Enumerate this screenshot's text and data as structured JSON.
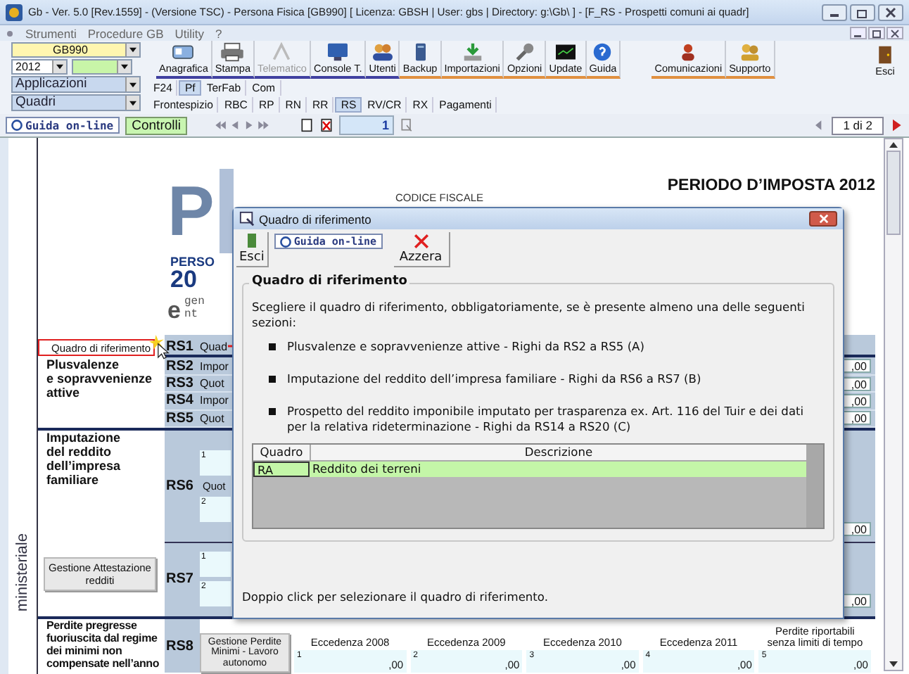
{
  "window": {
    "title": "Gb - Ver. 5.0 [Rev.1559] - (Versione TSC) -  Persona Fisica [GB990]     [ Licenza: GBSH | User: gbs | Directory: g:\\Gb\\ ] - [F_RS - Prospetti comuni ai quadr]"
  },
  "menu": [
    "Strumenti",
    "Procedure GB",
    "Utility",
    "?"
  ],
  "selectors": {
    "company": "GB990",
    "year": "2012",
    "applications": "Applicazioni",
    "frames": "Quadri"
  },
  "toolbar": [
    {
      "label": "Anagrafica",
      "disabled": false
    },
    {
      "label": "Stampa",
      "disabled": false
    },
    {
      "label": "Telematico",
      "disabled": true
    },
    {
      "label": "Console T.",
      "disabled": false
    },
    {
      "label": "Utenti",
      "disabled": false
    },
    {
      "label": "Backup",
      "disabled": false
    },
    {
      "label": "Importazioni",
      "disabled": false
    },
    {
      "label": "Opzioni",
      "disabled": false
    },
    {
      "label": "Update",
      "disabled": false
    },
    {
      "label": "Guida",
      "disabled": false
    }
  ],
  "toolbar_right": [
    {
      "label": "Comunicazioni"
    },
    {
      "label": "Supporto"
    }
  ],
  "exit_button": "Esci",
  "tabs": [
    {
      "label": "F24",
      "selected": false
    },
    {
      "label": "Pf",
      "selected": true
    },
    {
      "label": "TerFab",
      "selected": false
    },
    {
      "label": "Com",
      "selected": false
    }
  ],
  "subtabs": [
    {
      "label": "Frontespizio",
      "selected": false
    },
    {
      "label": "RBC",
      "selected": false
    },
    {
      "label": "RP",
      "selected": false
    },
    {
      "label": "RN",
      "selected": false
    },
    {
      "label": "RR",
      "selected": false
    },
    {
      "label": "RS",
      "selected": true
    },
    {
      "label": "RV/CR",
      "selected": false
    },
    {
      "label": "RX",
      "selected": false
    },
    {
      "label": "Pagamenti",
      "selected": false
    }
  ],
  "navbar": {
    "help": "Guida on-line",
    "checks": "Controlli",
    "page": "1",
    "page_count": "1 di 2"
  },
  "form": {
    "logo": {
      "mark": "P",
      "line1": "PERSO",
      "line2": "20",
      "agency_mark": "e",
      "agency1": "gen",
      "agency2": "nt"
    },
    "tax_code_label": "CODICE FISCALE",
    "period": "PERIODO D’IMPOSTA 2012",
    "side_label": "ministeriale",
    "reference_button": "Quadro di riferimento",
    "section_a": {
      "label": "Plusvalenze\ne sopravvenienze\nattive",
      "rows": [
        {
          "code": "RS1",
          "label": "Quad"
        },
        {
          "code": "RS2",
          "label": "Impor",
          "value": ",00"
        },
        {
          "code": "RS3",
          "label": "Quot",
          "value": ",00"
        },
        {
          "code": "RS4",
          "label": "Impor",
          "value": ",00"
        },
        {
          "code": "RS5",
          "label": "Quot",
          "value": ",00"
        }
      ]
    },
    "section_b": {
      "label": "Imputazione\ndel reddito\ndell’impresa\nfamiliare",
      "button": "Gestione Attestazione\nredditi",
      "rows": [
        {
          "code": "RS6",
          "fields": [
            "1",
            "2"
          ],
          "caption": "Quot",
          "value": ",00"
        },
        {
          "code": "RS7",
          "fields": [
            "1",
            "2"
          ],
          "value": ",00"
        }
      ]
    },
    "section_c": {
      "label": "Perdite pregresse\nfuoriuscita dal regime\ndei minimi non\ncompensate nell’anno",
      "code": "RS8",
      "button": "Gestione Perdite\nMinimi - Lavoro\nautonomo",
      "columns": [
        {
          "heading": "Eccedenza 2008",
          "number": "1",
          "value": ",00"
        },
        {
          "heading": "Eccedenza 2009",
          "number": "2",
          "value": ",00"
        },
        {
          "heading": "Eccedenza 2010",
          "number": "3",
          "value": ",00"
        },
        {
          "heading": "Eccedenza 2011",
          "number": "4",
          "value": ",00"
        },
        {
          "heading": "Perdite riportabili\nsenza limiti di tempo",
          "number": "5",
          "value": ",00"
        }
      ]
    }
  },
  "dialog": {
    "title": "Quadro di riferimento",
    "buttons": {
      "exit": "Esci",
      "help": "Guida on-line",
      "reset": "Azzera"
    },
    "group_title": "Quadro di riferimento",
    "intro": "Scegliere il quadro di riferimento, obbligatoriamente, se è presente almeno una delle seguenti sezioni:",
    "bullets": [
      "Plusvalenze e sopravvenienze attive - Righi da RS2 a RS5 (A)",
      "Imputazione del reddito dell’impresa familiare - Righi da RS6 a RS7 (B)",
      "Prospetto del reddito imponibile imputato per trasparenza ex. Art. 116 del Tuir e dei dati per la relativa rideterminazione - Righi da RS14 a RS20 (C)"
    ],
    "table": {
      "columns": [
        "Quadro",
        "Descrizione"
      ],
      "rows": [
        {
          "code": "RA",
          "description": "Reddito dei terreni",
          "selected": true
        }
      ]
    },
    "footer": "Doppio click per selezionare il quadro di riferimento."
  }
}
